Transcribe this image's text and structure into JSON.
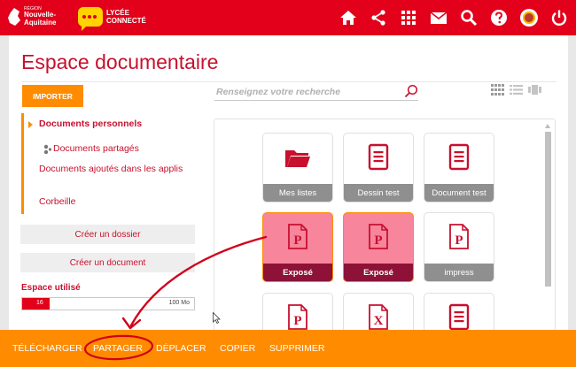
{
  "header": {
    "region_logo": {
      "small": "RÉGION",
      "line1": "Nouvelle-",
      "line2": "Aquitaine"
    },
    "lycee_logo": {
      "line1": "LYCÉE",
      "line2": "CONNECTÉ"
    },
    "icons": [
      "home-icon",
      "share-icon",
      "apps-grid-icon",
      "mail-icon",
      "search-icon",
      "help-icon",
      "avatar",
      "power-icon"
    ]
  },
  "page": {
    "title": "Espace documentaire",
    "import_label": "IMPORTER",
    "search_placeholder": "Renseignez votre recherche"
  },
  "tree": {
    "items": [
      {
        "label": "Documents personnels",
        "selected": true
      },
      {
        "label": "Documents partagés"
      },
      {
        "label": "Documents ajoutés dans les applis"
      },
      {
        "label": "Corbeille"
      }
    ]
  },
  "sidebar": {
    "create_folder": "Créer un dossier",
    "create_document": "Créer un document",
    "space_label": "Espace utilisé",
    "quota_used": "16",
    "quota_max": "100 Mo",
    "quota_fraction": 0.16
  },
  "files": [
    {
      "name": "Mes listes",
      "icon": "folder-icon",
      "selected": false
    },
    {
      "name": "Dessin test",
      "icon": "document-icon",
      "selected": false
    },
    {
      "name": "Document test",
      "icon": "document-icon",
      "selected": false
    },
    {
      "name": "Exposé",
      "icon": "presentation-icon",
      "selected": true
    },
    {
      "name": "Exposé",
      "icon": "presentation-icon",
      "selected": true
    },
    {
      "name": "impress",
      "icon": "presentation-icon",
      "selected": false
    },
    {
      "name": "",
      "icon": "presentation-icon",
      "selected": false
    },
    {
      "name": "",
      "icon": "spreadsheet-icon",
      "selected": false
    },
    {
      "name": "",
      "icon": "document-icon",
      "selected": false
    }
  ],
  "actions": [
    "TÉLÉCHARGER",
    "PARTAGER",
    "DÉPLACER",
    "COPIER",
    "SUPPRIMER"
  ],
  "colors": {
    "brand_red": "#e2001a",
    "accent_orange": "#ff8c00",
    "selected_tile": "#f7859c",
    "annotation": "#d0021b"
  }
}
